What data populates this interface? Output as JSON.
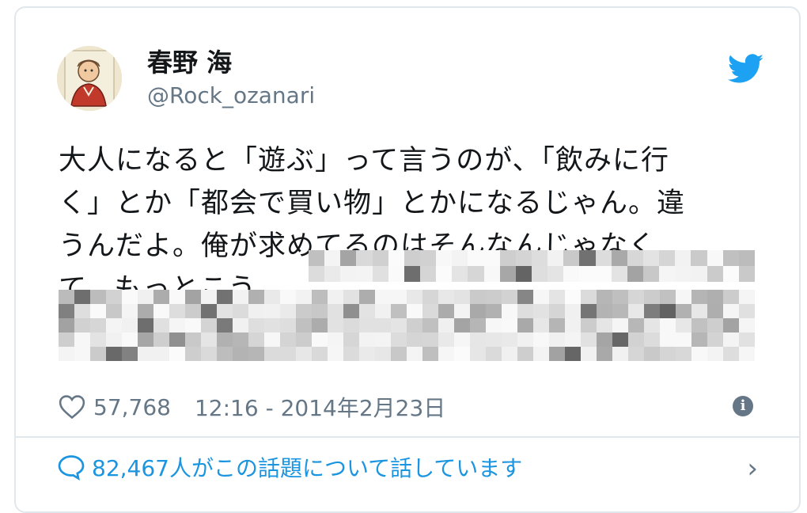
{
  "author": {
    "name": "春野 海",
    "handle": "@Rock_ozanari"
  },
  "tweet": {
    "line1": "大人になると「遊ぶ」って言うのが、「飲みに行",
    "line2": "く」とか「都会で買い物」とかになるじゃん。違",
    "line3": "うんだよ。俺が求めてるのはそんなんじゃなく",
    "line4_visible": "て、もっとこう、"
  },
  "meta": {
    "likes": "57,768",
    "timestamp": "12:16 - 2014年2月23日"
  },
  "footer": {
    "conversation": "82,467人がこの話題について話しています"
  },
  "colors": {
    "link": "#1b95e0",
    "secondary": "#657786",
    "text": "#14171a",
    "border": "#e1e8ed"
  },
  "icons": {
    "brand": "twitter-bird-icon",
    "like": "heart-icon",
    "info": "info-icon",
    "reply": "speech-bubble-icon",
    "more": "chevron-right-icon"
  }
}
